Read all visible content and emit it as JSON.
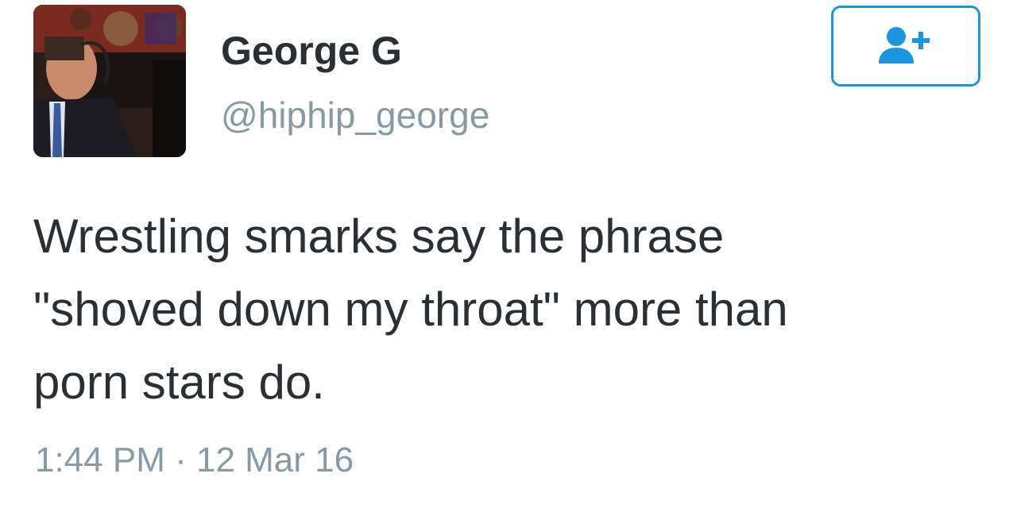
{
  "user": {
    "display_name": "George G",
    "handle": "@hiphip_george",
    "avatar_icon": "profile-photo"
  },
  "follow_button": {
    "icon": "follow-user-plus-icon",
    "accent_color": "#1b95e0"
  },
  "tweet": {
    "lines": [
      "Wrestling smarks say the phrase",
      "\"shoved down my throat\" more than",
      "porn stars do."
    ],
    "time": "1:44 PM",
    "separator": " · ",
    "date": "12 Mar 16"
  },
  "colors": {
    "text": "#292f33",
    "secondary_text": "#8899a6",
    "accent": "#1b95e0"
  }
}
